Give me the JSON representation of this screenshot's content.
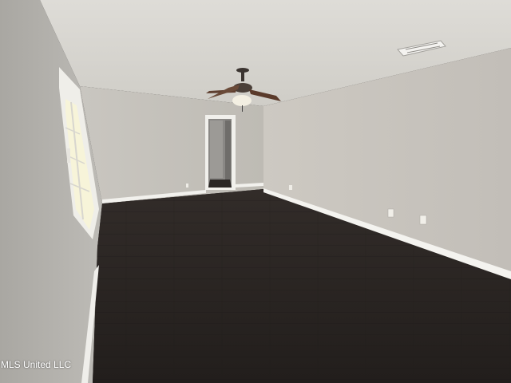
{
  "photo": {
    "watermark": "MLS United LLC",
    "colors": {
      "ceiling": "#dcdbd6",
      "wall_left": "#b9b7b2",
      "wall_back": "#c7c4bd",
      "wall_right": "#c8c5bf",
      "floor": "#2b2623",
      "trim": "#f4f3ef",
      "doorway": "#2c2b2a"
    }
  }
}
